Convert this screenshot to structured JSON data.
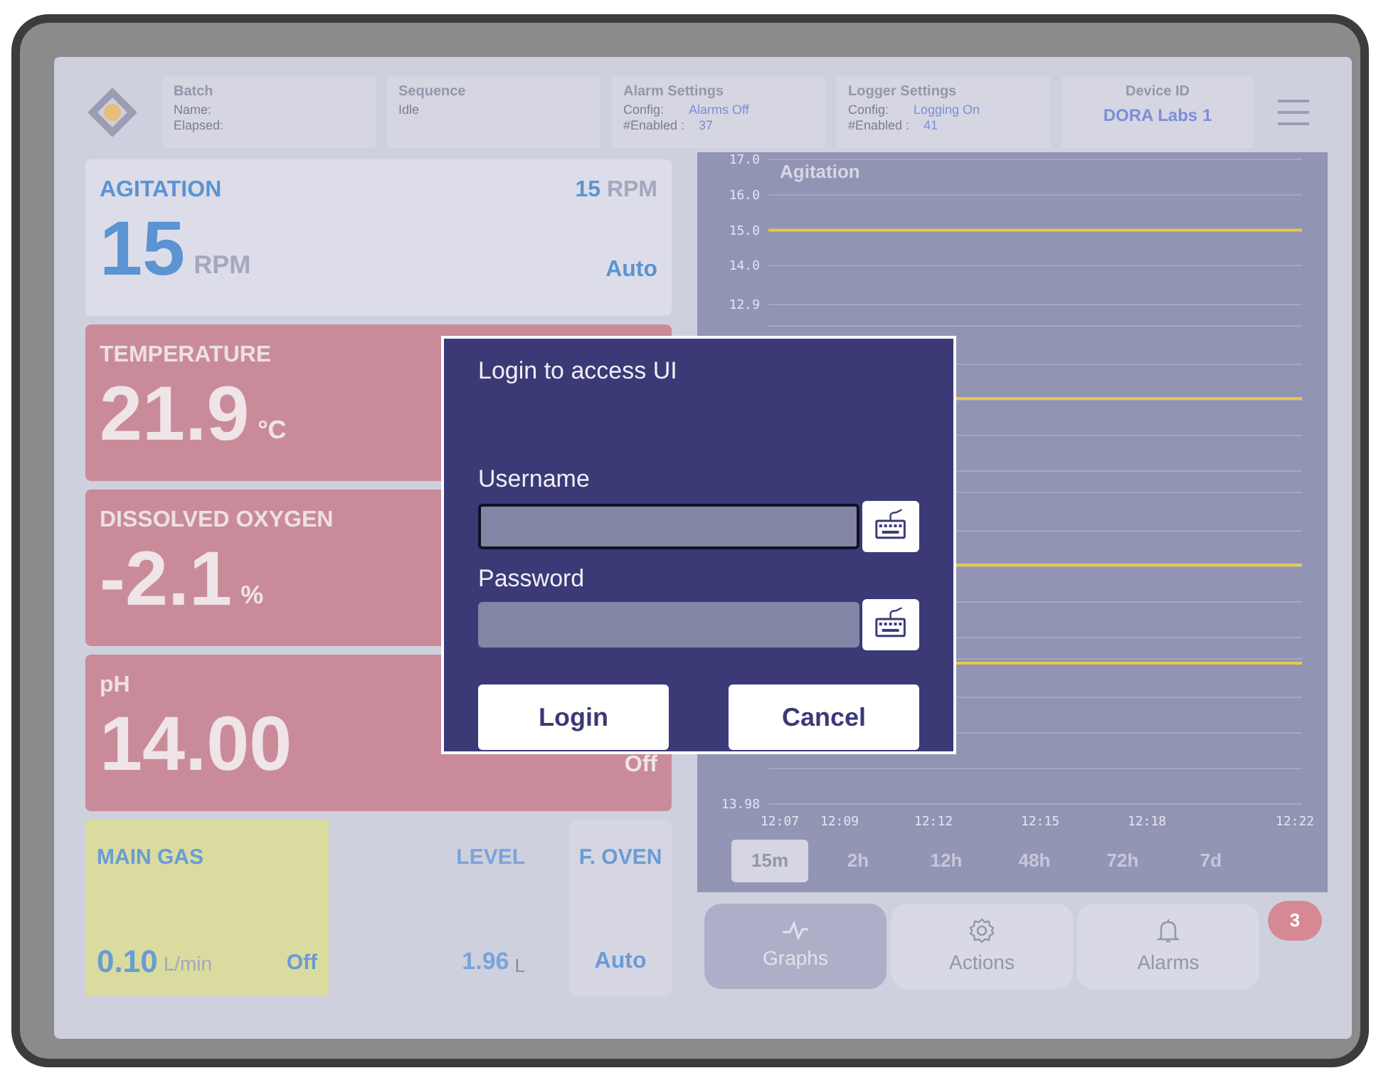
{
  "header": {
    "sections": [
      {
        "title": "Batch",
        "lines": [
          {
            "label": "Name:"
          },
          {
            "label": "Elapsed:"
          }
        ]
      },
      {
        "title": "Sequence",
        "lines": [
          {
            "label": "Idle"
          }
        ]
      },
      {
        "title": "Alarm Settings",
        "lines": [
          {
            "label": "Config:",
            "value": "Alarms Off"
          },
          {
            "label": "#Enabled :",
            "value": "37"
          }
        ]
      },
      {
        "title": "Logger Settings",
        "lines": [
          {
            "label": "Config:",
            "value": "Logging On"
          },
          {
            "label": "#Enabled :",
            "value": "41"
          }
        ]
      }
    ],
    "device": {
      "title": "Device ID",
      "value": "DORA Labs 1"
    }
  },
  "cards": [
    {
      "title": "AGITATION",
      "alarm": false,
      "setpoint": "15",
      "setpoint_unit": "RPM",
      "value": "15",
      "unit": "RPM",
      "mode": "Auto"
    },
    {
      "title": "TEMPERATURE",
      "alarm": true,
      "value": "21.9",
      "unit": "°C"
    },
    {
      "title": "DISSOLVED OXYGEN",
      "alarm": true,
      "value": "-2.1",
      "unit": "%"
    },
    {
      "title": "pH",
      "alarm": true,
      "value": "14.00",
      "mode": "Off"
    }
  ],
  "bottom_tiles": [
    {
      "kind": "gas",
      "title": "MAIN GAS",
      "value": "0.10",
      "unit": "L/min",
      "mode": "Off"
    },
    {
      "kind": "level",
      "title": "LEVEL",
      "value": "1.96",
      "unit": "L"
    },
    {
      "kind": "oven",
      "title": "F. OVEN",
      "mode": "Auto"
    }
  ],
  "charts": [
    {
      "chart_data": {
        "type": "line",
        "title": "Agitation",
        "grid": true,
        "ylim": [
          12.9,
          17.0
        ],
        "yticks": [
          {
            "value": 17,
            "label": "17.0"
          },
          {
            "value": 16,
            "label": "16.0"
          },
          {
            "value": 15,
            "label": "15.0"
          },
          {
            "value": 14,
            "label": "14.0"
          },
          {
            "value": 12.9,
            "label": "12.9"
          }
        ],
        "series": [
          {
            "color": "#e6c84a",
            "values": [
              15,
              15,
              15,
              15,
              15,
              15,
              15,
              15,
              15,
              15,
              15,
              15
            ]
          }
        ]
      }
    },
    {
      "kind": "picture"
    },
    {
      "kind": "picture"
    },
    {
      "kind": "picture",
      "y_tick": "13.98",
      "x_ticks": [
        "12:07",
        "12:09",
        "12:12",
        "12:15",
        "12:18",
        "12:22"
      ]
    }
  ],
  "ranges": [
    {
      "label": "15m",
      "selected": true
    },
    {
      "label": "2h",
      "selected": false
    },
    {
      "label": "12h",
      "selected": false
    },
    {
      "label": "48h",
      "selected": false
    },
    {
      "label": "72h",
      "selected": false
    },
    {
      "label": "7d",
      "selected": false
    }
  ],
  "nav": [
    {
      "kind": "graphs",
      "label": "Graphs",
      "selected": true
    },
    {
      "kind": "actions",
      "label": "Actions",
      "selected": false
    },
    {
      "kind": "alarms",
      "label": "Alarms",
      "selected": false,
      "badge": "3"
    }
  ],
  "dialog": {
    "title": "Login to access UI",
    "fields": [
      {
        "label": "Username",
        "focused": true
      },
      {
        "label": "Password",
        "focused": false
      }
    ],
    "buttons": [
      "Login",
      "Cancel"
    ]
  }
}
